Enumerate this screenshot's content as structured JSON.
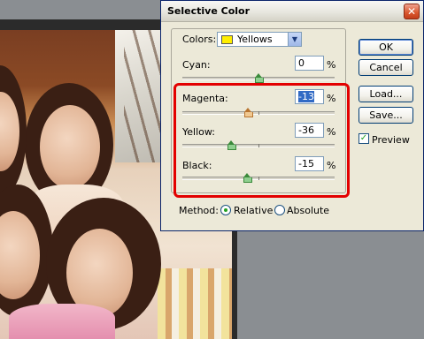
{
  "dialog": {
    "title": "Selective Color",
    "close_glyph": "✕",
    "colors_label": "Colors:",
    "colors_value": "Yellows",
    "colors_swatch": "#ffee00",
    "percent_sign": "%",
    "sliders": [
      {
        "label": "Cyan:",
        "value": "0",
        "level_pct": 0
      },
      {
        "label": "Magenta:",
        "value": "-13",
        "level_pct": -13
      },
      {
        "label": "Yellow:",
        "value": "-36",
        "level_pct": -36
      },
      {
        "label": "Black:",
        "value": "-15",
        "level_pct": -15
      }
    ],
    "method_label": "Method:",
    "method_options": [
      {
        "label": "Relative",
        "checked": true
      },
      {
        "label": "Absolute",
        "checked": false
      }
    ],
    "buttons": {
      "ok": "OK",
      "cancel": "Cancel",
      "load": "Load...",
      "save": "Save..."
    },
    "preview_label": "Preview",
    "preview_checked": true,
    "highlight_color": "#e30000"
  },
  "icons": {
    "close": "close-icon",
    "dropdown": "chevron-down-icon",
    "checkmark": "check-icon"
  }
}
